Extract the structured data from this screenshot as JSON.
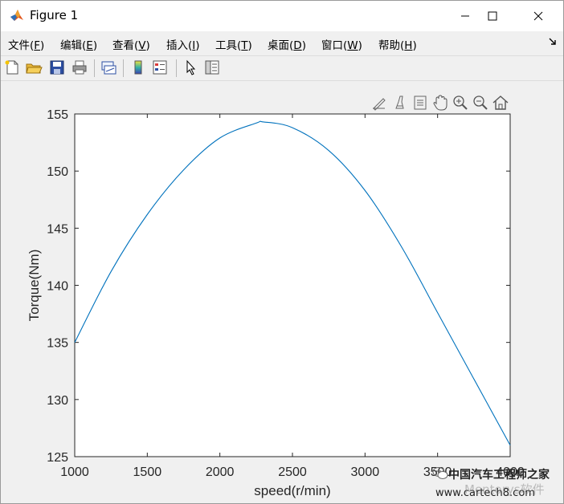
{
  "window": {
    "title": "Figure 1",
    "icons": [
      "matlab-logo-icon",
      "minimize-icon",
      "maximize-icon",
      "close-icon"
    ]
  },
  "menu": {
    "items": [
      {
        "text": "文件(",
        "key": "F",
        "end": ")"
      },
      {
        "text": "编辑(",
        "key": "E",
        "end": ")"
      },
      {
        "text": "查看(",
        "key": "V",
        "end": ")"
      },
      {
        "text": "插入(",
        "key": "I",
        "end": ")"
      },
      {
        "text": "工具(",
        "key": "T",
        "end": ")"
      },
      {
        "text": "桌面(",
        "key": "D",
        "end": ")"
      },
      {
        "text": "窗口(",
        "key": "W",
        "end": ")"
      },
      {
        "text": "帮助(",
        "key": "H",
        "end": ")"
      }
    ],
    "overflow_icon": "dock-arrow-icon"
  },
  "toolbar": {
    "icons": [
      "new-figure-icon",
      "open-file-icon",
      "save-icon",
      "print-icon",
      "link-plot-icon",
      "colorbar-icon",
      "legend-icon",
      "select-pointer-icon",
      "property-inspector-icon"
    ]
  },
  "axes_toolbar": {
    "icons": [
      "edit-data-icon",
      "brush-icon",
      "data-tips-icon",
      "pan-hand-icon",
      "zoom-in-icon",
      "zoom-out-icon",
      "home-restore-icon"
    ]
  },
  "chart_data": {
    "type": "line",
    "xlabel": "speed(r/min)",
    "ylabel": "Torque(Nm)",
    "xlim": [
      1000,
      4000
    ],
    "ylim": [
      125,
      155
    ],
    "xticks": [
      "1000",
      "1500",
      "2000",
      "2500",
      "3000",
      "3500",
      "4000"
    ],
    "yticks": [
      "125",
      "130",
      "135",
      "140",
      "145",
      "150",
      "155"
    ],
    "series": [
      {
        "color": "#0072BD",
        "x": [
          1000,
          1250,
          1500,
          1750,
          2000,
          2250,
          2300,
          2500,
          2750,
          3000,
          3250,
          3500,
          3750,
          4000
        ],
        "y": [
          135.0,
          141.2,
          146.2,
          150.1,
          152.9,
          154.2,
          154.3,
          153.8,
          151.8,
          148.3,
          143.4,
          137.6,
          131.8,
          126.0
        ]
      }
    ],
    "grid": false
  },
  "watermark": {
    "line1": "中国汽车工程师之家",
    "line2": "www.cartech8.com",
    "overlay": "Mentorys软件"
  }
}
